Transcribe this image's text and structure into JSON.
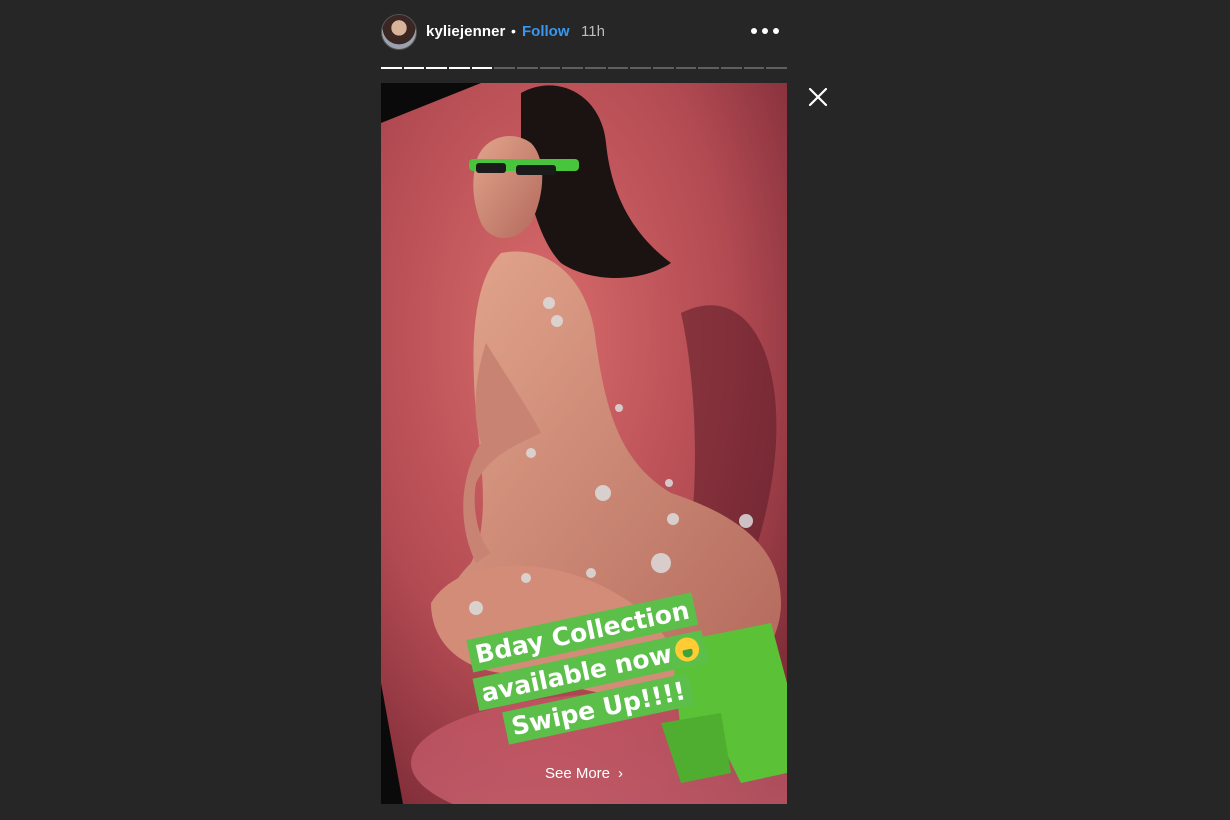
{
  "header": {
    "username": "kyliejenner",
    "separator": "•",
    "follow_label": "Follow",
    "time": "11h",
    "avatar_icon": "profile-avatar",
    "more_icon": "more-options-icon"
  },
  "progress": {
    "total_segments": 18,
    "completed_segments": 5
  },
  "close_icon": "close-icon",
  "story": {
    "caption_lines": [
      "Bday Collection",
      "available now",
      "Swipe Up!!!!"
    ],
    "caption_emoji": "money-mouth-face-emoji",
    "see_more_label": "See More",
    "see_more_icon": "chevron-right-icon"
  },
  "colors": {
    "background": "#262626",
    "follow": "#3897f0",
    "caption_bg": "#5bbf4a",
    "story_bg": "#b14a52"
  }
}
